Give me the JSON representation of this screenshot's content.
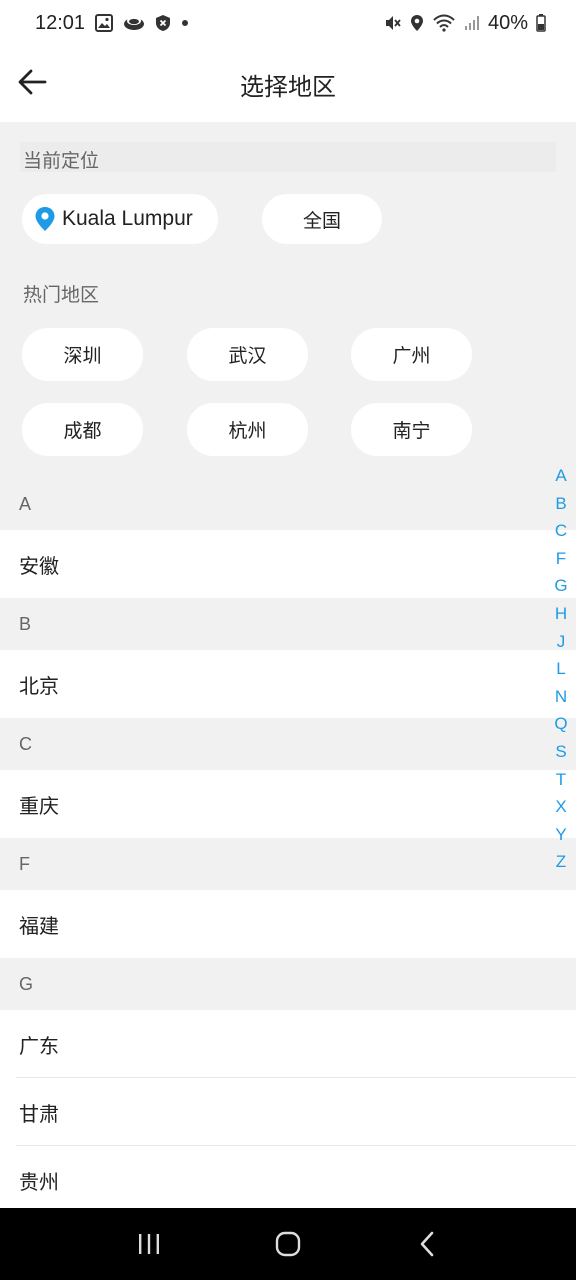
{
  "status_bar": {
    "time": "12:01",
    "battery": "40%"
  },
  "header": {
    "title": "选择地区"
  },
  "current_location": {
    "label": "当前定位",
    "location": "Kuala Lumpur",
    "nationwide": "全国"
  },
  "hot_regions": {
    "label": "热门地区",
    "items": [
      "深圳",
      "武汉",
      "广州",
      "成都",
      "杭州",
      "南宁"
    ]
  },
  "groups": [
    {
      "letter": "A",
      "cities": [
        "安徽"
      ]
    },
    {
      "letter": "B",
      "cities": [
        "北京"
      ]
    },
    {
      "letter": "C",
      "cities": [
        "重庆"
      ]
    },
    {
      "letter": "F",
      "cities": [
        "福建"
      ]
    },
    {
      "letter": "G",
      "cities": [
        "广东",
        "甘肃",
        "贵州"
      ]
    }
  ],
  "side_index": [
    "A",
    "B",
    "C",
    "F",
    "G",
    "H",
    "J",
    "L",
    "N",
    "Q",
    "S",
    "T",
    "X",
    "Y",
    "Z"
  ],
  "colors": {
    "accent": "#1e9be6",
    "section_bg": "#f1f1f1"
  }
}
